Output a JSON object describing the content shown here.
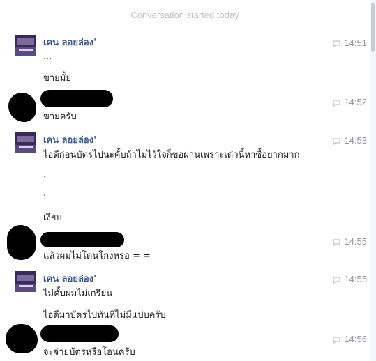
{
  "banner": "Conversation started today",
  "messages": [
    {
      "sender": "เคน ลอยล่อง'",
      "time": "14:51",
      "lines": [
        "...",
        "ขายมั้ย"
      ]
    },
    {
      "sender": "",
      "time": "14:52",
      "lines": [
        "ขายครับ"
      ]
    },
    {
      "sender": "เคน ลอยล่อง'",
      "time": "14:53",
      "lines": [
        "ไอดีก่อนบัตรไปนะคั้บถ้าไม่ไว้ใจก็ขอผ่านเพราะเด๋วนี้หาซื้อยากมาก",
        ".",
        ".",
        "เงียบ"
      ]
    },
    {
      "sender": "",
      "time": "14:55",
      "lines": [
        "แล้วผมไม่โดนโกงหรอ = ="
      ]
    },
    {
      "sender": "เคน ลอยล่อง'",
      "time": "14:55",
      "lines": [
        "ไม่คั้บผมไม่เกรียน",
        "ไอดีมาบัตรไปทันทีไม่มีแปบครับ"
      ]
    },
    {
      "sender": "",
      "time": "14:56",
      "lines": [
        "จะจ่ายบัตรหรือโอนครับ"
      ]
    }
  ],
  "icons": {
    "timestamp_icon": "speech-bubble-icon"
  },
  "colors": {
    "sender_name": "#3b5998",
    "timestamp": "#90949c",
    "banner": "#bec3c9",
    "redaction": "#000000"
  }
}
